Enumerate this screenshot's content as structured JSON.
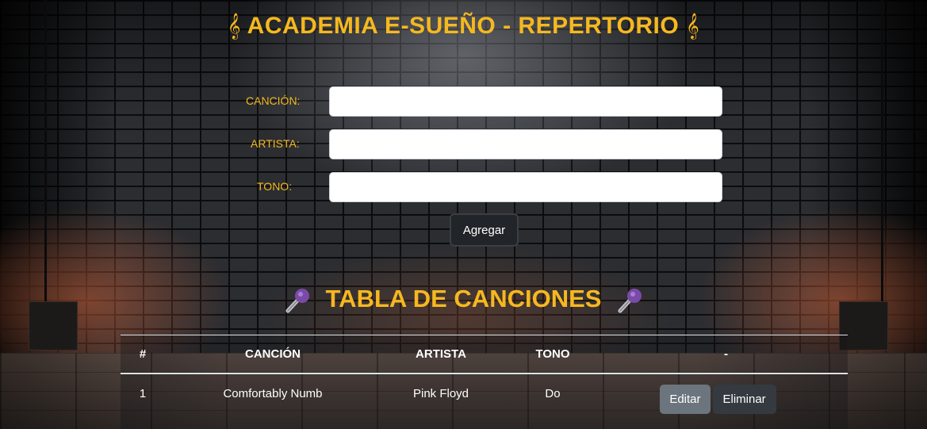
{
  "header": {
    "title": "ACADEMIA E-SUEÑO - REPERTORIO",
    "clef_glyph": "𝄞",
    "accent_color": "#f6b81f"
  },
  "form": {
    "fields": [
      {
        "label": "CANCIÓN:",
        "value": ""
      },
      {
        "label": "ARTISTA:",
        "value": ""
      },
      {
        "label": "TONO:",
        "value": ""
      }
    ],
    "submit_label": "Agregar"
  },
  "songs_section": {
    "title": "TABLA DE CANCIONES",
    "icon": "microphone-icon",
    "columns": [
      "#",
      "CANCIÓN",
      "ARTISTA",
      "TONO",
      "-"
    ],
    "rows": [
      {
        "num": "1",
        "song": "Comfortably Numb",
        "artist": "Pink Floyd",
        "key": "Do",
        "edit_label": "Editar",
        "delete_label": "Eliminar"
      }
    ]
  }
}
